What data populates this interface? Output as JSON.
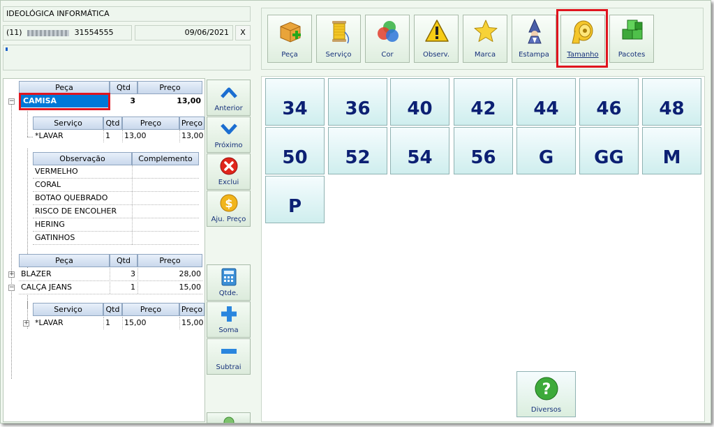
{
  "company": "IDEOLÓGICA INFORMÁTICA",
  "phone_prefix": "(11)",
  "phone_number": "31554555",
  "date": "09/06/2021",
  "close_label": "X",
  "toolbar": [
    {
      "label": "Peça",
      "icon": "box-plus-icon"
    },
    {
      "label": "Serviço",
      "icon": "thread-spool-icon"
    },
    {
      "label": "Cor",
      "icon": "color-circles-icon"
    },
    {
      "label": "Observ.",
      "icon": "warning-icon"
    },
    {
      "label": "Marca",
      "icon": "star-icon"
    },
    {
      "label": "Estampa",
      "icon": "wizard-icon"
    },
    {
      "label": "Tamanho",
      "icon": "measuring-tape-icon"
    },
    {
      "label": "Pacotes",
      "icon": "green-cubes-icon"
    }
  ],
  "main_grid": {
    "headers": [
      "Peça",
      "Qtd",
      "Preço"
    ],
    "selected_item": {
      "peca": "CAMISA",
      "qtd": "3",
      "preco": "13,00"
    },
    "service_headers": [
      "Serviço",
      "Qtd",
      "Preço",
      "Preço"
    ],
    "service_row": {
      "servico": "*LAVAR",
      "qtd": "1",
      "preco": "13,00",
      "preco2": "13,00"
    },
    "obs_headers": [
      "Observação",
      "Complemento"
    ],
    "obs_rows": [
      "VERMELHO",
      "CORAL",
      "BOTAO QUEBRADO",
      "RISCO DE ENCOLHER",
      "HERING",
      "GATINHOS"
    ]
  },
  "second_grid": {
    "headers": [
      "Peça",
      "Qtd",
      "Preço"
    ],
    "rows": [
      {
        "peca": "BLAZER",
        "qtd": "3",
        "preco": "28,00"
      },
      {
        "peca": "CALÇA JEANS",
        "qtd": "1",
        "preco": "15,00"
      }
    ],
    "service_headers": [
      "Serviço",
      "Qtd",
      "Preço",
      "Preço"
    ],
    "service_row": {
      "servico": "*LAVAR",
      "qtd": "1",
      "preco": "15,00",
      "preco2": "15,00"
    }
  },
  "side_buttons": [
    {
      "label": "Anterior",
      "icon": "chevron-up-icon"
    },
    {
      "label": "Próximo",
      "icon": "chevron-down-icon"
    },
    {
      "label": "Exclui",
      "icon": "delete-icon"
    },
    {
      "label": "Aju. Preço",
      "icon": "dollar-coin-icon"
    },
    {
      "label": "Qtde.",
      "icon": "calculator-icon"
    },
    {
      "label": "Soma",
      "icon": "plus-icon"
    },
    {
      "label": "Subtrai",
      "icon": "minus-icon"
    }
  ],
  "sizes": [
    "34",
    "36",
    "40",
    "42",
    "44",
    "46",
    "48",
    "50",
    "52",
    "54",
    "56",
    "G",
    "GG",
    "M",
    "P"
  ],
  "diversos_label": "Diversos",
  "colors": {
    "selection": "#0078d7",
    "highlight_frame": "#e0141e",
    "size_text": "#0c2073"
  }
}
